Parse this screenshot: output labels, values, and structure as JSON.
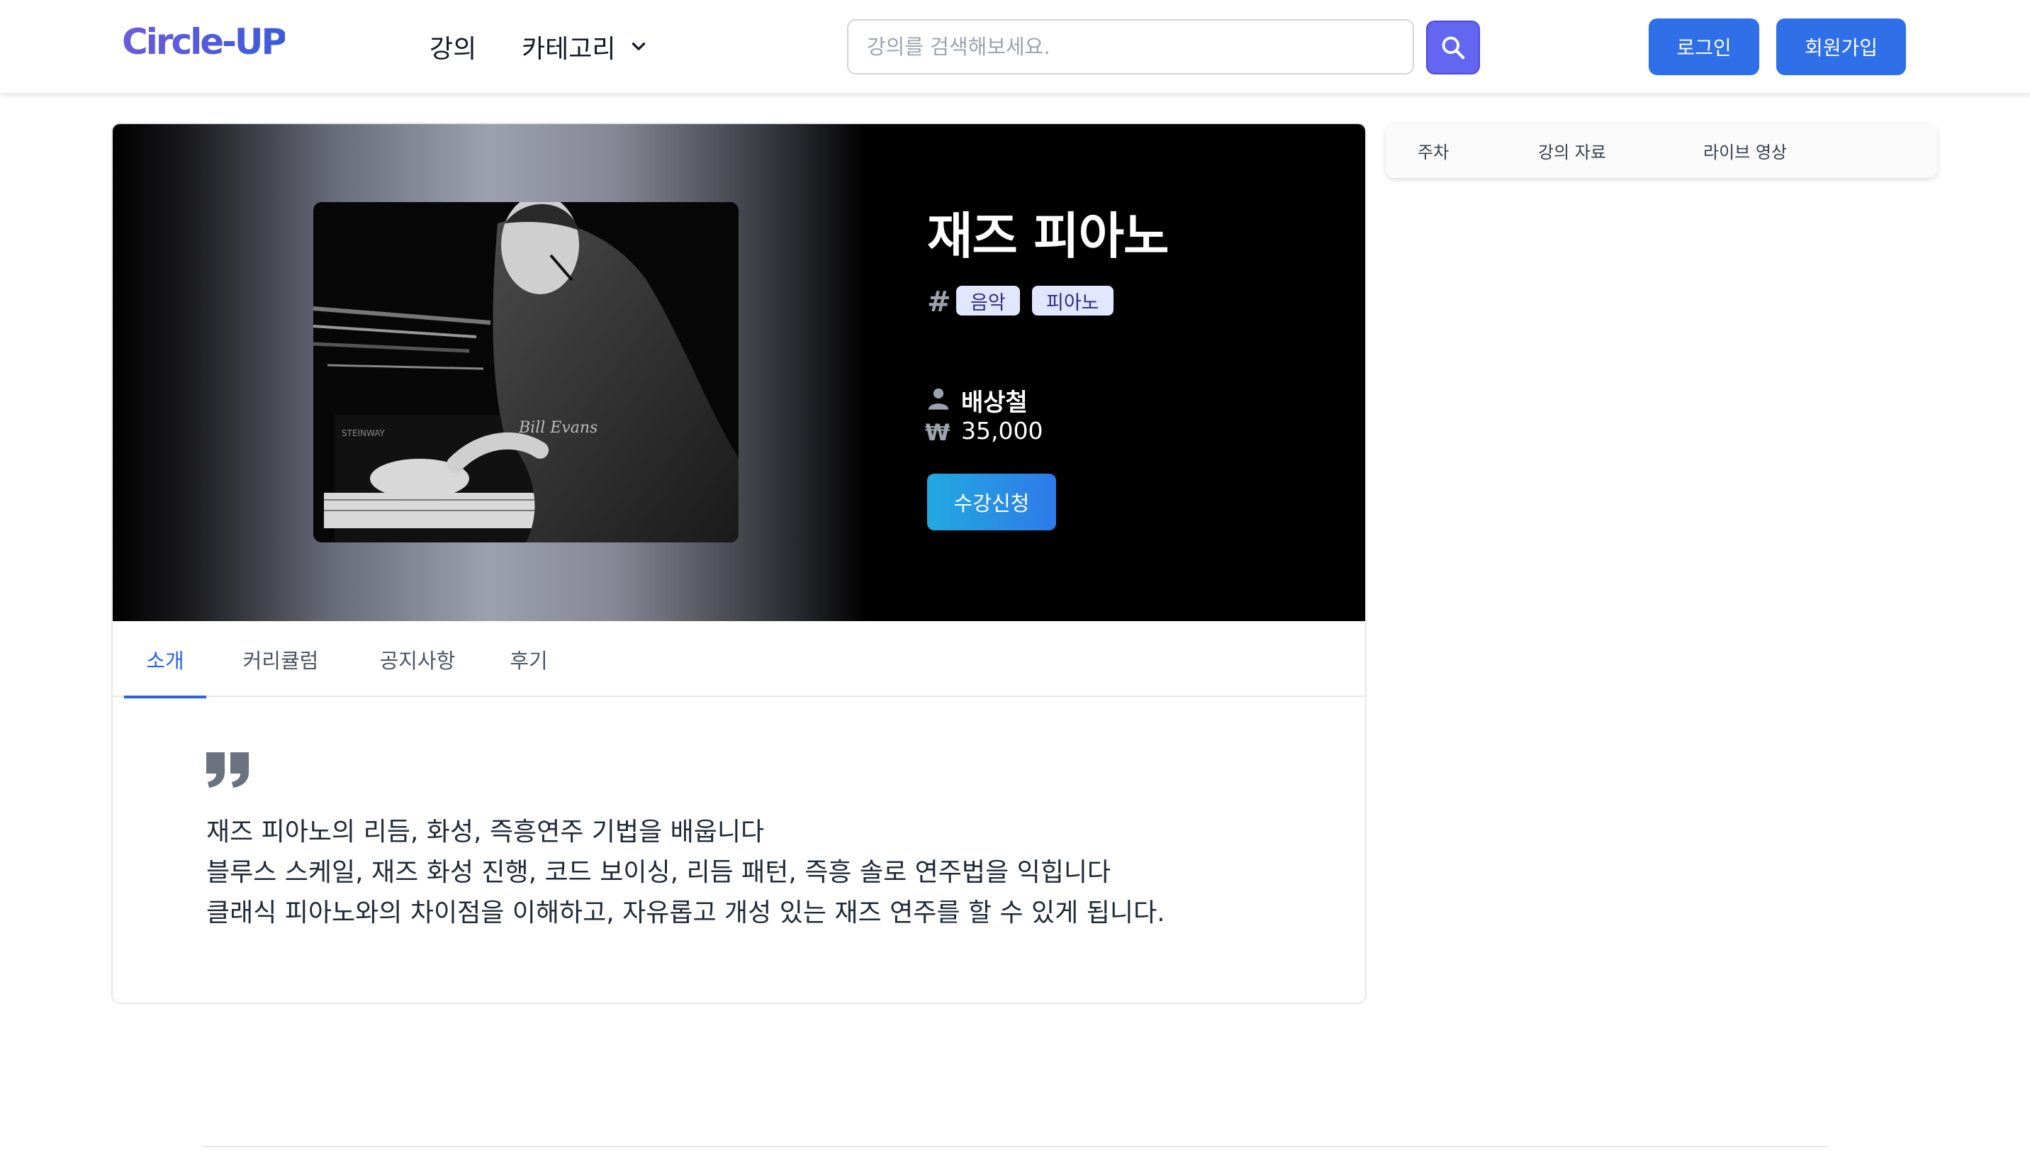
{
  "header": {
    "logo": "Circle-UP",
    "nav": {
      "lecture": "강의",
      "category": "카테고리"
    },
    "search": {
      "placeholder": "강의를 검색해보세요.",
      "value": ""
    },
    "login": "로그인",
    "signup": "회원가입"
  },
  "course": {
    "title": "재즈 피아노",
    "tags": [
      "음악",
      "피아노"
    ],
    "instructor": "배상철",
    "price": "35,000",
    "enroll": "수강신청",
    "photo_caption": "Bill Evans"
  },
  "tabs": [
    "소개",
    "커리큘럼",
    "공지사항",
    "후기"
  ],
  "intro": {
    "lines": [
      "재즈 피아노의 리듬, 화성, 즉흥연주 기법을 배웁니다",
      "블루스 스케일, 재즈 화성 진행, 코드 보이싱, 리듬 패턴, 즉흥 솔로 연주법을 익힙니다",
      "클래식 피아노와의 차이점을 이해하고, 자유롭고 개성 있는 재즈 연주를 할 수 있게 됩니다."
    ]
  },
  "side_panel": {
    "week": "주차",
    "material": "강의 자료",
    "live": "라이브 영상"
  },
  "icons": {
    "search": "search-icon",
    "chevron": "chevron-down-icon",
    "hash": "#",
    "person": "person-icon",
    "won": "₩",
    "quote": "quote-icon"
  },
  "colors": {
    "primary": "#2f6fe8",
    "search_button": "#6366f1",
    "active_tab": "#2563eb",
    "tag_bg": "#e0e7ff"
  }
}
